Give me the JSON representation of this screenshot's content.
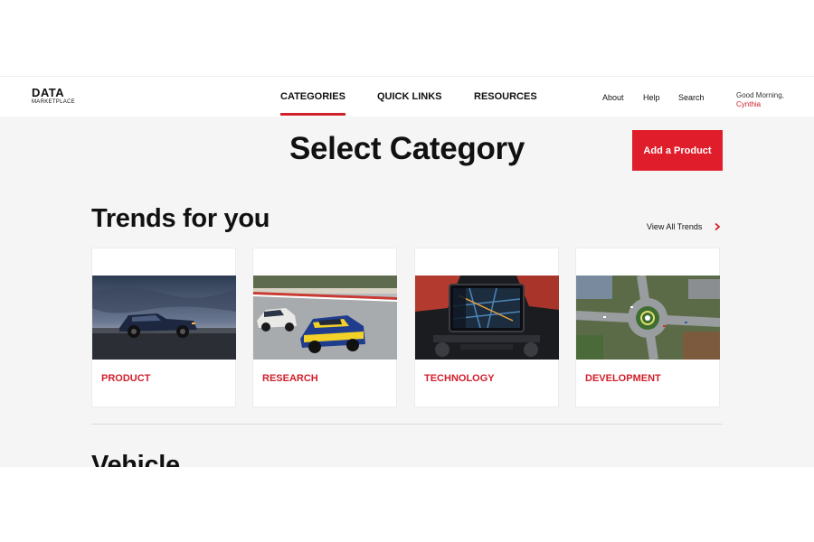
{
  "brand": {
    "logo_main": "DATA",
    "logo_sub": "MARKETPLACE"
  },
  "nav": {
    "items": [
      {
        "label": "CATEGORIES",
        "active": true
      },
      {
        "label": "QUICK LINKS",
        "active": false
      },
      {
        "label": "RESOURCES",
        "active": false
      }
    ]
  },
  "utility": {
    "about": "About",
    "help": "Help",
    "search": "Search",
    "greeting": "Good Morning,",
    "user_name": "Cynthia"
  },
  "page": {
    "title": "Select Category",
    "add_button": "Add a Product"
  },
  "trends": {
    "heading": "Trends for you",
    "view_all": "View All Trends",
    "cards": [
      {
        "label": "PRODUCT",
        "image": "pickup-truck-photo"
      },
      {
        "label": "RESEARCH",
        "image": "race-car-photo"
      },
      {
        "label": "TECHNOLOGY",
        "image": "dashboard-screen-photo"
      },
      {
        "label": "DEVELOPMENT",
        "image": "roundabout-aerial-photo"
      }
    ]
  },
  "next_section": {
    "heading": "Vehicle"
  },
  "colors": {
    "accent": "#d11f2b",
    "button": "#e01e2b",
    "background": "#f5f5f5"
  }
}
